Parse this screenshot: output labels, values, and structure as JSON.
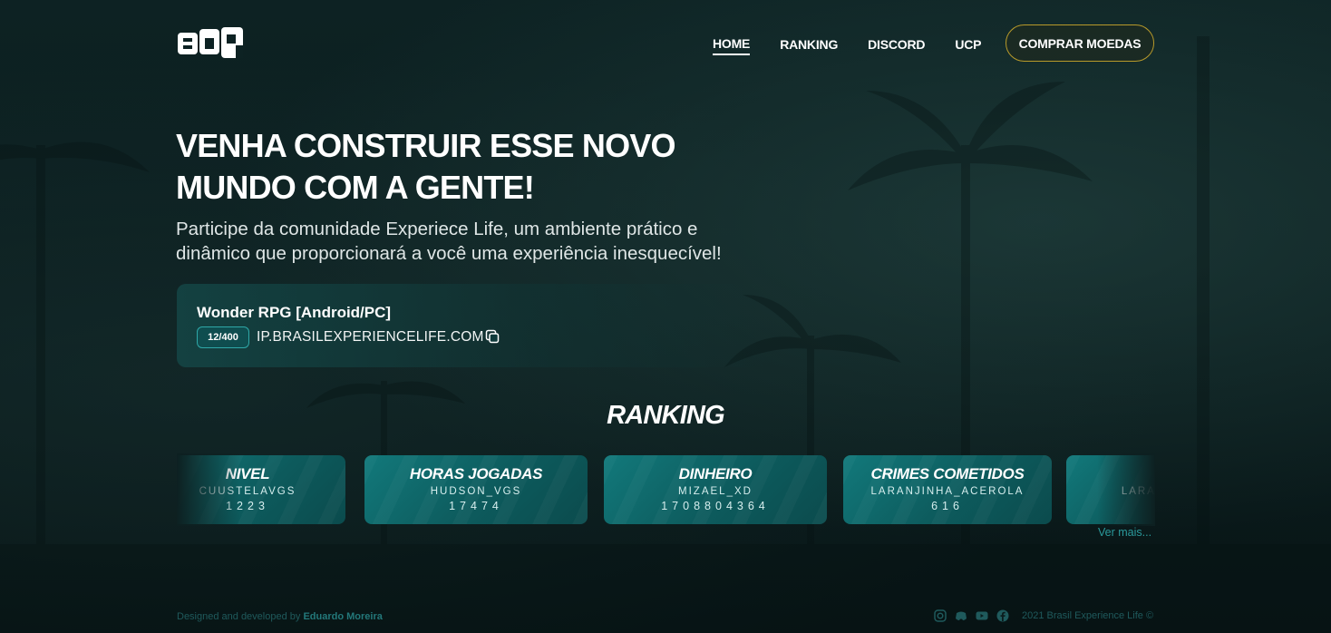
{
  "nav": {
    "items": [
      {
        "label": "HOME",
        "active": true
      },
      {
        "label": "RANKING",
        "active": false
      },
      {
        "label": "DISCORD",
        "active": false
      },
      {
        "label": "UCP",
        "active": false
      }
    ],
    "buy_button": "COMPRAR MOEDAS",
    "logo_icon": "ebp-logo-icon"
  },
  "hero": {
    "title_line1": "VENHA CONSTRUIR ESSE NOVO",
    "title_line2": "MUNDO COM A GENTE!",
    "subtitle_line1": "Participe da comunidade Experiece Life, um ambiente prático e",
    "subtitle_line2": "dinâmico que proporcionará a você uma experiência inesquecível!"
  },
  "server": {
    "name": "Wonder RPG [Android/PC]",
    "players": "12/400",
    "ip": "IP.BRASILEXPERIENCELIFE.COM",
    "copy_icon": "copy-icon"
  },
  "ranking": {
    "title": "RANKING",
    "cards": [
      {
        "category": "NIVEL",
        "player": "CUUSTELAVGS",
        "value": "1223"
      },
      {
        "category": "HORAS JOGADAS",
        "player": "HUDSON_VGS",
        "value": "17474"
      },
      {
        "category": "DINHEIRO",
        "player": "MIZAEL_XD",
        "value": "1708804364"
      },
      {
        "category": "CRIMES COMETIDOS",
        "player": "LARANJINHA_ACEROLA",
        "value": "616"
      },
      {
        "category": "",
        "player": "LARAN",
        "value": ""
      }
    ],
    "see_more": "Ver mais..."
  },
  "footer": {
    "credit_prefix": "Designed and developed by",
    "credit_name": "Eduardo Moreira",
    "social_icons": [
      "instagram-icon",
      "discord-icon",
      "youtube-icon",
      "facebook-icon"
    ],
    "copyright": "2021 Brasil Experience Life ©"
  },
  "colors": {
    "background": "#0b1c1d",
    "accent_teal": "#12797b",
    "button_border": "#b89a2a"
  }
}
